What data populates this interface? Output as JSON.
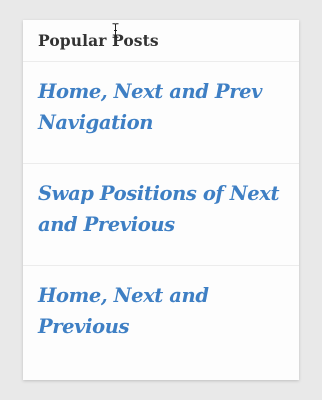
{
  "widget": {
    "title": "Popular Posts"
  },
  "posts": [
    {
      "title": "Home, Next and Prev Navigation"
    },
    {
      "title": "Swap Positions of Next and Previous"
    },
    {
      "title": "Home, Next and Previous"
    }
  ],
  "colors": {
    "page_background": "#e9e9e9",
    "card_background": "#fdfdfd",
    "title_text": "#333333",
    "link": "#3e7fc4",
    "divider": "#ececec"
  },
  "icons": {
    "cursor": "text-cursor-icon"
  }
}
